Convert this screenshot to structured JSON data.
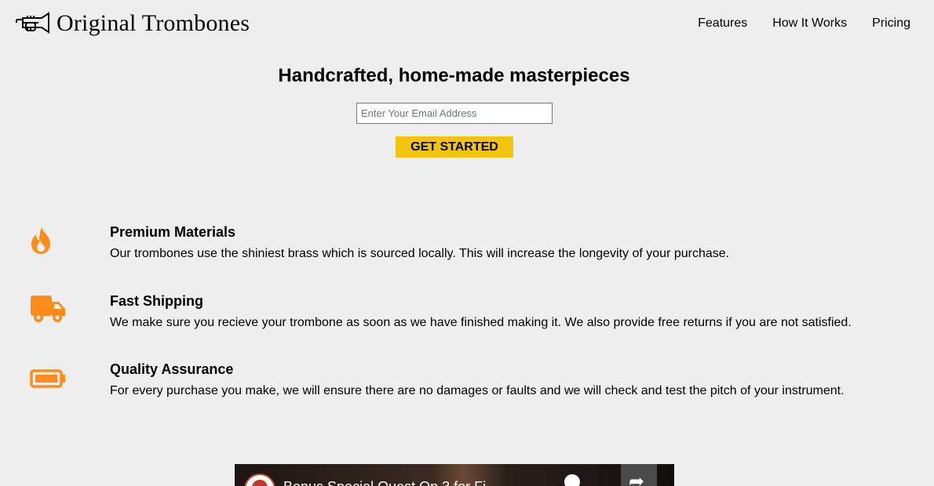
{
  "header": {
    "logo_icon": "trumpet-icon",
    "brand": "Original Trombones",
    "nav": [
      "Features",
      "How It Works",
      "Pricing"
    ]
  },
  "hero": {
    "title": "Handcrafted, home-made masterpieces",
    "email_placeholder": "Enter Your Email Address",
    "cta_label": "GET STARTED"
  },
  "features": [
    {
      "icon": "fire-icon",
      "title": "Premium Materials",
      "description": "Our trombones use the shiniest brass which is sourced locally. This will increase the longevity of your purchase."
    },
    {
      "icon": "truck-icon",
      "title": "Fast Shipping",
      "description": "We make sure you recieve your trombone as soon as we have finished making it. We also provide free returns if you are not satisfied."
    },
    {
      "icon": "battery-icon",
      "title": "Quality Assurance",
      "description": "For every purchase you make, we will ensure there are no damages or faults and we will check and test the pitch of your instrument."
    }
  ],
  "video": {
    "title": "Bonus Special Quest Op 3 for Fi"
  },
  "colors": {
    "accent": "#f1c40f",
    "icon_orange": "#ff8c1a",
    "background": "#eeeeee"
  }
}
